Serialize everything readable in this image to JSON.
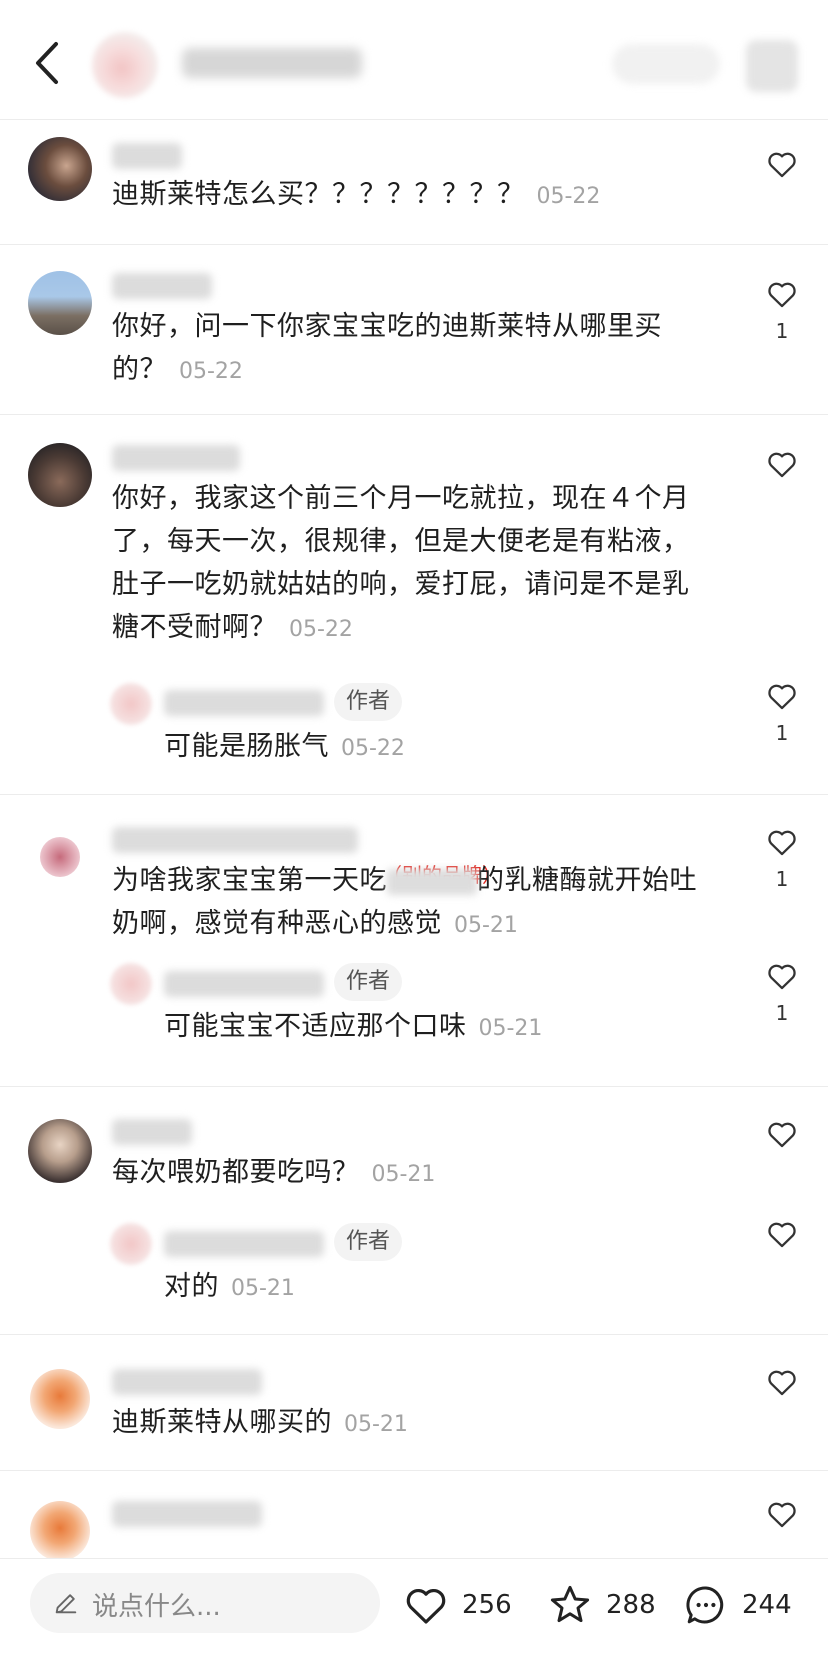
{
  "header": {
    "back_icon": "chevron-left-icon"
  },
  "comments": [
    {
      "text": "迪斯莱特怎么买？？？？？？？？",
      "date": "05-22",
      "likes": ""
    },
    {
      "text_line1": "你好，问一下你家宝宝吃的迪斯莱特从哪里买",
      "text_line2": "的？",
      "date": "05-22",
      "likes": "1"
    },
    {
      "text_line1": "你好，我家这个前三个月一吃就拉，现在４个月",
      "text_line2": "了，每天一次，很规律，但是大便老是有粘液，",
      "text_line3": "肚子一吃奶就姑姑的响，爱打屁，请问是不是乳",
      "text_line4": "糖不受耐啊？",
      "date": "05-22",
      "likes": "",
      "reply": {
        "tag": "作者",
        "text": "可能是肠胀气",
        "date": "05-22",
        "likes": "1"
      }
    },
    {
      "text_line1_a": "为啥我家宝宝第一天吃",
      "text_line1_b": "的乳糖酶就开始吐",
      "note": "（别的品牌）",
      "text_line2": "奶啊，感觉有种恶心的感觉",
      "date": "05-21",
      "likes": "1",
      "reply": {
        "tag": "作者",
        "text": "可能宝宝不适应那个口味",
        "date": "05-21",
        "likes": "1"
      }
    },
    {
      "text": "每次喂奶都要吃吗？",
      "date": "05-21",
      "likes": "",
      "reply": {
        "tag": "作者",
        "text": "对的",
        "date": "05-21",
        "likes": ""
      }
    },
    {
      "text": "迪斯莱特从哪买的",
      "date": "05-21",
      "likes": ""
    }
  ],
  "bottom_bar": {
    "input_placeholder": "说点什么...",
    "like_count": "256",
    "collect_count": "288",
    "comment_count": "244"
  },
  "colors": {
    "note_red": "#e0231b",
    "date_gray": "#a3a3a3"
  }
}
